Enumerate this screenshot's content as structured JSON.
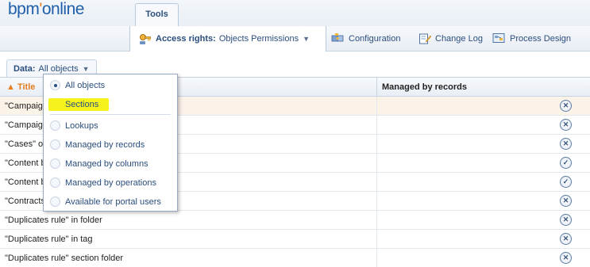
{
  "logo": {
    "prefix": "bpm",
    "dot": "'",
    "suffix": "online"
  },
  "tabs": {
    "tools": "Tools"
  },
  "toolbar": {
    "access_rights_label": "Access rights:",
    "access_rights_value": "Objects Permissions",
    "configuration": "Configuration",
    "change_log": "Change Log",
    "process_design": "Process Design"
  },
  "data_filter": {
    "label": "Data:",
    "value": "All objects"
  },
  "grid": {
    "columns": {
      "title": "Title",
      "managed": "Managed by records"
    },
    "rows": [
      {
        "title": "\"Campaign",
        "managed_state": "cross"
      },
      {
        "title": "\"Campaign",
        "managed_state": "cross"
      },
      {
        "title": "\"Cases\" ob",
        "managed_state": "cross"
      },
      {
        "title": "\"Content b",
        "managed_state": "check"
      },
      {
        "title": "\"Content b",
        "managed_state": "check"
      },
      {
        "title": "\"Contracts",
        "managed_state": "cross"
      },
      {
        "title": "\"Duplicates rule\" in folder",
        "managed_state": "cross"
      },
      {
        "title": "\"Duplicates rule\" in tag",
        "managed_state": "cross"
      },
      {
        "title": "\"Duplicates rule\" section folder",
        "managed_state": "cross"
      }
    ]
  },
  "dropdown": {
    "items": [
      {
        "label": "All objects",
        "selected": true
      },
      {
        "label": "Sections",
        "selected": false,
        "highlight_color": "#f5f21c"
      },
      {
        "label": "Lookups",
        "selected": false
      },
      {
        "label": "Managed by records",
        "selected": false
      },
      {
        "label": "Managed by columns",
        "selected": false
      },
      {
        "label": "Managed by operations",
        "selected": false
      },
      {
        "label": "Available for portal users",
        "selected": false
      }
    ]
  },
  "colors": {
    "accent": "#e67e22",
    "link": "#2a4e7e",
    "brand": "#1f5ea8"
  }
}
